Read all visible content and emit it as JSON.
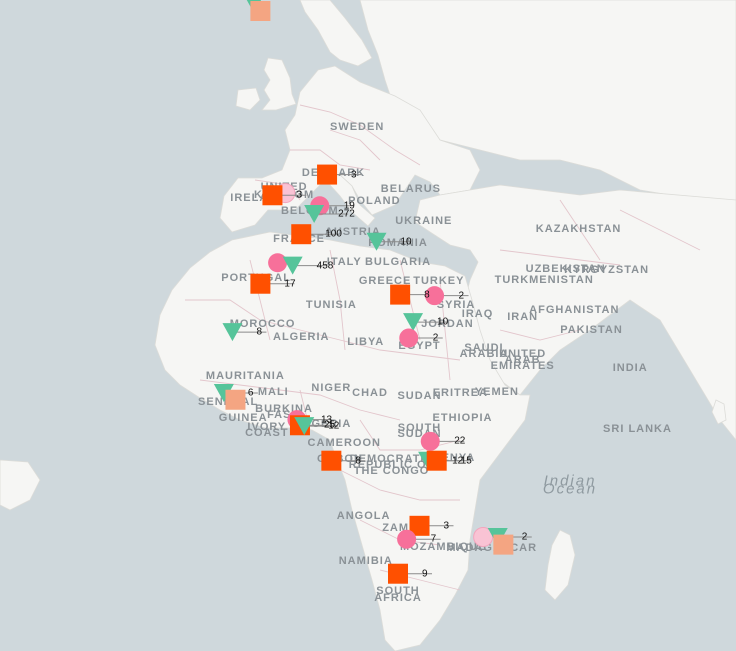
{
  "colors": {
    "ocean": "#cfd8dc",
    "land": "#f6f6f4",
    "border": "#e3c6cc",
    "square": "#ff5000",
    "square_faded": "#f4a582",
    "circle": "#f7709a",
    "circle_faded": "#f9c3d4",
    "triangle": "#56c49a",
    "leader": "#8a8a8a"
  },
  "places": [
    {
      "name": "SWEDEN",
      "lon": 15.5,
      "lat": 61.5
    },
    {
      "name": "UNITED",
      "lon": -1.5,
      "lat": 54.2
    },
    {
      "name": "KINGDOM",
      "lon": -1.5,
      "lat": 53.0
    },
    {
      "name": "DENMARK",
      "lon": 10.0,
      "lat": 56.0
    },
    {
      "name": "IRELAND",
      "lon": -7.5,
      "lat": 52.6
    },
    {
      "name": "BELARUS",
      "lon": 28.0,
      "lat": 53.8
    },
    {
      "name": "POLAND",
      "lon": 19.5,
      "lat": 52.2
    },
    {
      "name": "BELGIUM",
      "lon": 4.5,
      "lat": 50.7
    },
    {
      "name": "UKRAINE",
      "lon": 31.0,
      "lat": 49.2
    },
    {
      "name": "AUSTRIA",
      "lon": 14.5,
      "lat": 47.6
    },
    {
      "name": "FRANCE",
      "lon": 2.0,
      "lat": 46.5
    },
    {
      "name": "KAZAKHSTAN",
      "lon": 67.0,
      "lat": 48.0
    },
    {
      "name": "ROMANIA",
      "lon": 25.0,
      "lat": 45.8
    },
    {
      "name": "BULGARIA",
      "lon": 25.0,
      "lat": 42.7
    },
    {
      "name": "ITALY",
      "lon": 12.5,
      "lat": 42.6
    },
    {
      "name": "UZBEKISTAN",
      "lon": 64.0,
      "lat": 41.5
    },
    {
      "name": "KYRGYZSTAN",
      "lon": 73.5,
      "lat": 41.3
    },
    {
      "name": "PORTUGAL",
      "lon": -8.0,
      "lat": 39.8
    },
    {
      "name": "GREECE",
      "lon": 22.0,
      "lat": 39.3
    },
    {
      "name": "TURKEY",
      "lon": 34.5,
      "lat": 39.3
    },
    {
      "name": "TURKMENISTAN",
      "lon": 59.0,
      "lat": 39.5
    },
    {
      "name": "TUNISIA",
      "lon": 9.5,
      "lat": 34.8
    },
    {
      "name": "SYRIA",
      "lon": 38.5,
      "lat": 34.8
    },
    {
      "name": "IRAQ",
      "lon": 43.5,
      "lat": 33.2
    },
    {
      "name": "IRAN",
      "lon": 54.0,
      "lat": 32.5
    },
    {
      "name": "AFGHANISTAN",
      "lon": 66.0,
      "lat": 33.8
    },
    {
      "name": "MOROCCO",
      "lon": -6.5,
      "lat": 31.2
    },
    {
      "name": "JORDAN",
      "lon": 36.5,
      "lat": 31.2
    },
    {
      "name": "PAKISTAN",
      "lon": 70.0,
      "lat": 30.0
    },
    {
      "name": "ALGERIA",
      "lon": 2.5,
      "lat": 28.5
    },
    {
      "name": "LIBYA",
      "lon": 17.5,
      "lat": 27.5
    },
    {
      "name": "EGYPT",
      "lon": 30.0,
      "lat": 26.6
    },
    {
      "name": "SAUDI",
      "lon": 45.0,
      "lat": 26.3
    },
    {
      "name": "ARABIA",
      "lon": 45.0,
      "lat": 24.9
    },
    {
      "name": "INDIA",
      "lon": 79.0,
      "lat": 22.0
    },
    {
      "name": "UNITED",
      "lon": 54.0,
      "lat": 25.0
    },
    {
      "name": "ARAB",
      "lon": 54.0,
      "lat": 23.7
    },
    {
      "name": "EMIRATES",
      "lon": 54.0,
      "lat": 22.4
    },
    {
      "name": "MAURITANIA",
      "lon": -10.5,
      "lat": 20.2
    },
    {
      "name": "NIGER",
      "lon": 9.5,
      "lat": 17.6
    },
    {
      "name": "MALI",
      "lon": -4.0,
      "lat": 16.8
    },
    {
      "name": "CHAD",
      "lon": 18.5,
      "lat": 16.5
    },
    {
      "name": "SUDAN",
      "lon": 30.0,
      "lat": 15.8
    },
    {
      "name": "ERITREA",
      "lon": 39.5,
      "lat": 16.5
    },
    {
      "name": "YEMEN",
      "lon": 48.0,
      "lat": 16.8
    },
    {
      "name": "SENEGAL",
      "lon": -14.5,
      "lat": 14.6
    },
    {
      "name": "BURKINA",
      "lon": -1.5,
      "lat": 12.8
    },
    {
      "name": "FASO",
      "lon": -1.5,
      "lat": 11.5
    },
    {
      "name": "GUINEA",
      "lon": -11.0,
      "lat": 10.8
    },
    {
      "name": "NIGERIA",
      "lon": 8.0,
      "lat": 9.5
    },
    {
      "name": "ETHIOPIA",
      "lon": 40.0,
      "lat": 10.8
    },
    {
      "name": "IVORY",
      "lon": -5.5,
      "lat": 8.8
    },
    {
      "name": "COAST",
      "lon": -5.5,
      "lat": 7.5
    },
    {
      "name": "SRI LANKA",
      "lon": 80.7,
      "lat": 8.3
    },
    {
      "name": "SOUTH",
      "lon": 30.0,
      "lat": 8.5
    },
    {
      "name": "SUDAN",
      "lon": 30.0,
      "lat": 7.2
    },
    {
      "name": "CAMEROON",
      "lon": 12.5,
      "lat": 5.2
    },
    {
      "name": "GABON",
      "lon": 11.5,
      "lat": 1.4
    },
    {
      "name": "KENYA",
      "lon": 38.0,
      "lat": 1.6
    },
    {
      "name": "DEMOCRATIC",
      "lon": 23.5,
      "lat": 1.3
    },
    {
      "name": "REPUBLIC OF",
      "lon": 23.5,
      "lat": 0.0
    },
    {
      "name": "THE CONGO",
      "lon": 23.5,
      "lat": -1.3
    },
    {
      "name": "ANGOLA",
      "lon": 17.0,
      "lat": -11.8
    },
    {
      "name": "ZAMBIA",
      "lon": 27.0,
      "lat": -14.5
    },
    {
      "name": "MOZAMBIQUE",
      "lon": 35.5,
      "lat": -18.8
    },
    {
      "name": "MADAGASCAR",
      "lon": 46.8,
      "lat": -19.0
    },
    {
      "name": "NAMIBIA",
      "lon": 17.5,
      "lat": -21.8
    },
    {
      "name": "SOUTH",
      "lon": 25.0,
      "lat": -28.2
    },
    {
      "name": "AFRICA",
      "lon": 25.0,
      "lat": -29.5
    }
  ],
  "oceans": [
    {
      "name": "Indian",
      "lon": 65.0,
      "lat": -3.8
    },
    {
      "name": "Ocean",
      "lon": 65.0,
      "lat": -5.6
    }
  ],
  "markers": [
    {
      "shape": "triangle",
      "faded": false,
      "lon": -8.5,
      "lat": 72.5,
      "count": ""
    },
    {
      "shape": "square",
      "faded": true,
      "lon": -7.0,
      "lat": 72.0,
      "count": ""
    },
    {
      "shape": "square",
      "faded": false,
      "lon": 8.5,
      "lat": 55.8,
      "count": "3"
    },
    {
      "shape": "circle",
      "faded": true,
      "lon": -1.2,
      "lat": 53.3,
      "count": ""
    },
    {
      "shape": "square",
      "faded": false,
      "lon": -4.2,
      "lat": 53.0,
      "count": "3"
    },
    {
      "shape": "circle",
      "faded": false,
      "lon": 6.8,
      "lat": 51.5,
      "count": "19"
    },
    {
      "shape": "triangle",
      "faded": false,
      "lon": 5.5,
      "lat": 50.3,
      "count": "272"
    },
    {
      "shape": "square",
      "faded": false,
      "lon": 2.5,
      "lat": 47.2,
      "count": "100"
    },
    {
      "shape": "triangle",
      "faded": false,
      "lon": 20.0,
      "lat": 46.0,
      "count": "10"
    },
    {
      "shape": "circle",
      "faded": false,
      "lon": -3.0,
      "lat": 42.5,
      "count": ""
    },
    {
      "shape": "triangle",
      "faded": false,
      "lon": 0.5,
      "lat": 42.0,
      "count": "458"
    },
    {
      "shape": "square",
      "faded": false,
      "lon": -7.0,
      "lat": 38.8,
      "count": "17"
    },
    {
      "shape": "square",
      "faded": false,
      "lon": 25.5,
      "lat": 36.8,
      "count": "8"
    },
    {
      "shape": "circle",
      "faded": false,
      "lon": 33.5,
      "lat": 36.6,
      "count": "2"
    },
    {
      "shape": "triangle",
      "faded": false,
      "lon": 28.5,
      "lat": 31.5,
      "count": "10"
    },
    {
      "shape": "circle",
      "faded": false,
      "lon": 27.5,
      "lat": 28.3,
      "count": "2"
    },
    {
      "shape": "triangle",
      "faded": false,
      "lon": -13.5,
      "lat": 29.5,
      "count": "8"
    },
    {
      "shape": "triangle",
      "faded": false,
      "lon": -15.5,
      "lat": 16.5,
      "count": "6"
    },
    {
      "shape": "square",
      "faded": true,
      "lon": -12.8,
      "lat": 15.0,
      "count": ""
    },
    {
      "shape": "circle",
      "faded": false,
      "lon": 1.5,
      "lat": 10.5,
      "count": "13"
    },
    {
      "shape": "square",
      "faded": false,
      "lon": 2.2,
      "lat": 9.2,
      "count": "25"
    },
    {
      "shape": "triangle",
      "faded": false,
      "lon": 3.2,
      "lat": 9.0,
      "count": "12"
    },
    {
      "shape": "circle",
      "faded": false,
      "lon": 32.5,
      "lat": 5.5,
      "count": "22"
    },
    {
      "shape": "square",
      "faded": false,
      "lon": 9.5,
      "lat": 1.0,
      "count": "8"
    },
    {
      "shape": "triangle",
      "faded": false,
      "lon": 32.0,
      "lat": 1.0,
      "count": "12"
    },
    {
      "shape": "square",
      "faded": false,
      "lon": 34.0,
      "lat": 1.0,
      "count": "15"
    },
    {
      "shape": "square",
      "faded": false,
      "lon": 30.0,
      "lat": -14.0,
      "count": "3"
    },
    {
      "shape": "circle",
      "faded": false,
      "lon": 27.0,
      "lat": -17.0,
      "count": "7"
    },
    {
      "shape": "circle",
      "faded": true,
      "lon": 44.8,
      "lat": -16.5,
      "count": ""
    },
    {
      "shape": "triangle",
      "faded": false,
      "lon": 48.2,
      "lat": -16.5,
      "count": "2"
    },
    {
      "shape": "square",
      "faded": true,
      "lon": 49.5,
      "lat": -18.2,
      "count": ""
    },
    {
      "shape": "square",
      "faded": false,
      "lon": 25.0,
      "lat": -24.5,
      "count": "9"
    }
  ]
}
